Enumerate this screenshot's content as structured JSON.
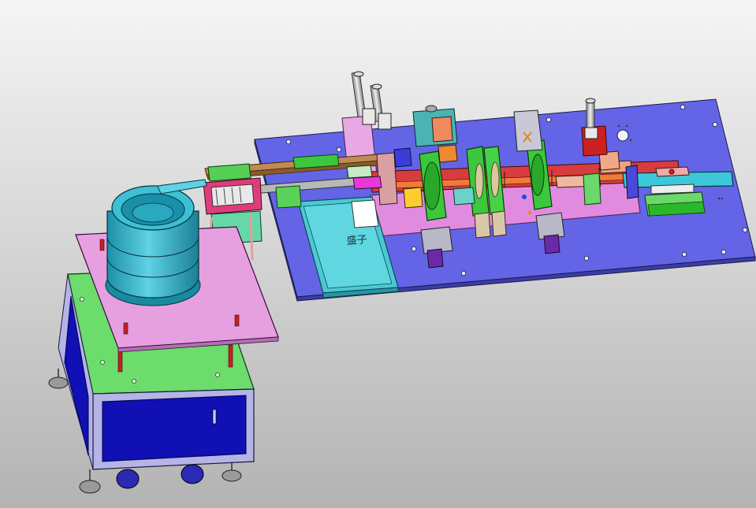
{
  "scene": {
    "tray_label": "盛子",
    "background_top": "#f4f4f4",
    "background_bottom": "#b5b5b5"
  },
  "colors": {
    "base_plate": "#6464e6",
    "pink_plate": "#e6a0e0",
    "green_panel": "#6cdc6c",
    "cabinet_blue": "#1010b4",
    "cabinet_frame": "#b4b4e6",
    "bowl_teal": "#2ab0c8",
    "tray_teal": "#4cc8d4",
    "gear_green": "#3cc83c",
    "rail_red": "#e02020",
    "cylinder_gray": "#bcbcbc"
  }
}
